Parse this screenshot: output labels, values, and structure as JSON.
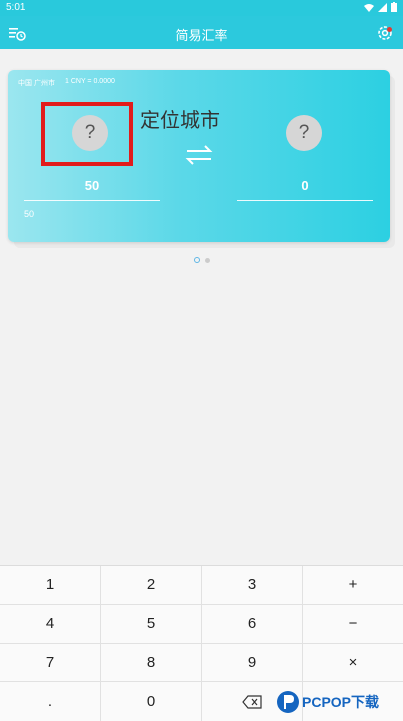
{
  "status": {
    "time": "5:01"
  },
  "appbar": {
    "title": "简易汇率"
  },
  "card": {
    "location": "中国 广州市",
    "rate": "1 CNY = 0.0000",
    "left_flag": "?",
    "right_flag": "?",
    "locate_label": "定位城市",
    "left_amount": "50",
    "right_amount": "0",
    "left_sub": "50"
  },
  "keypad": {
    "rows": [
      [
        "1",
        "2",
        "3",
        "+"
      ],
      [
        "4",
        "5",
        "6",
        "−"
      ],
      [
        "7",
        "8",
        "9",
        "×"
      ],
      [
        ".",
        "0",
        "",
        ""
      ]
    ]
  },
  "watermark": {
    "text": "PCPOP下载"
  },
  "colors": {
    "accent": "#2cc9dd",
    "highlight": "#e21b1b"
  }
}
